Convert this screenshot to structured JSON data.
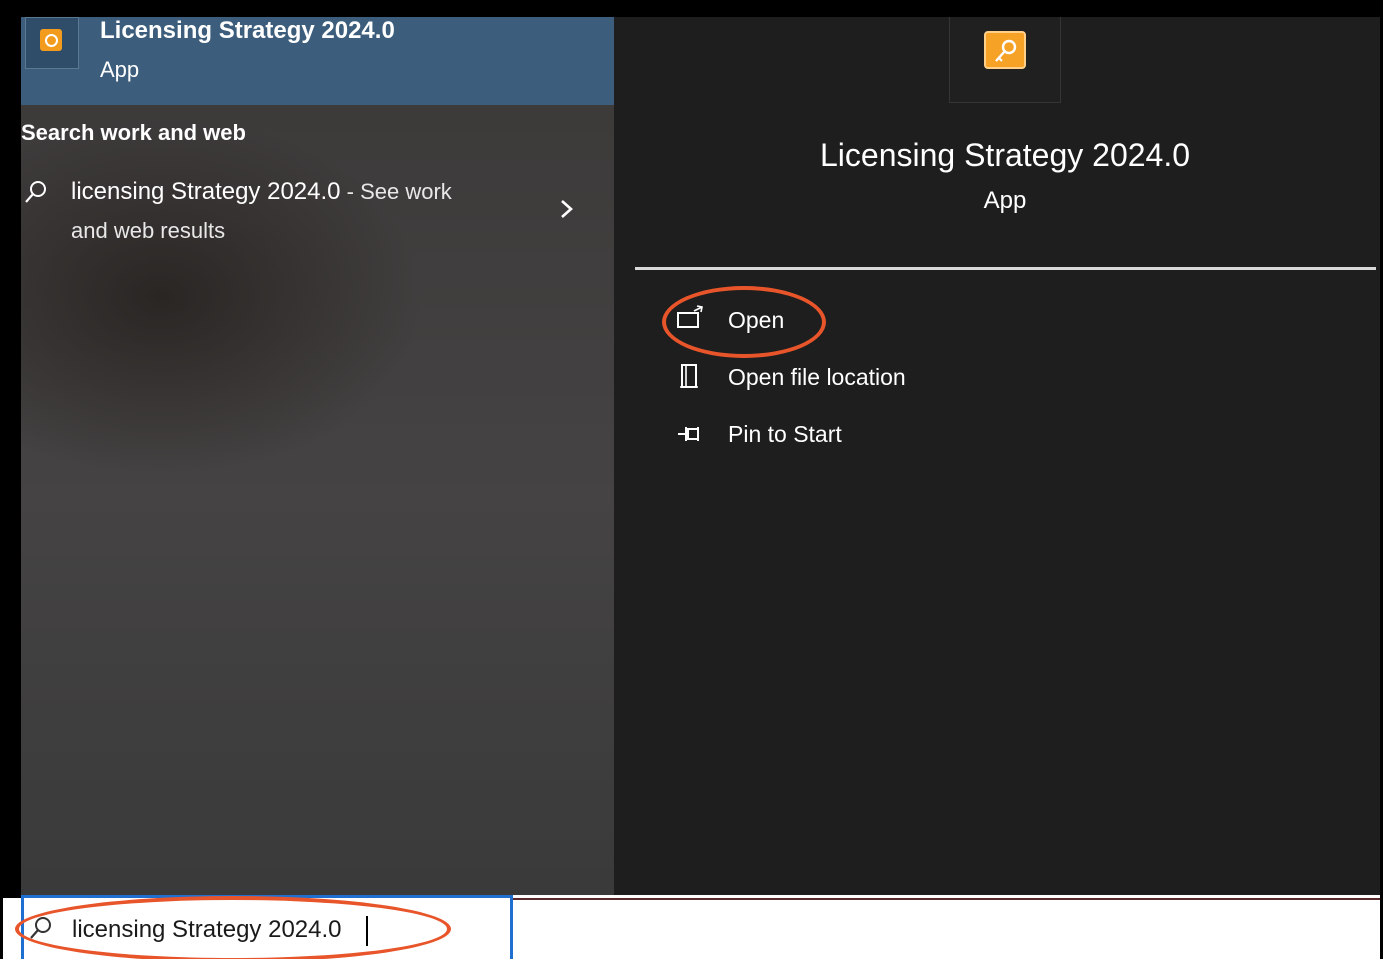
{
  "best_match": {
    "title": "Licensing Strategy 2024.0",
    "subtitle": "App"
  },
  "left": {
    "section_heading": "Search work and web",
    "web_result": {
      "query": "licensing Strategy 2024.0",
      "suffix": " - See work",
      "line2": "and web results"
    }
  },
  "right": {
    "title": "Licensing Strategy 2024.0",
    "subtitle": "App",
    "actions": [
      {
        "label": "Open",
        "icon": "open-icon"
      },
      {
        "label": "Open file location",
        "icon": "file-location-icon"
      },
      {
        "label": "Pin to Start",
        "icon": "pin-icon"
      }
    ]
  },
  "search": {
    "value": "licensing Strategy 2024.0"
  },
  "colors": {
    "accent": "#3c5d7b",
    "annotation": "#e8552a",
    "app_icon": "#f5a227",
    "focus_border": "#1f6fd1"
  }
}
